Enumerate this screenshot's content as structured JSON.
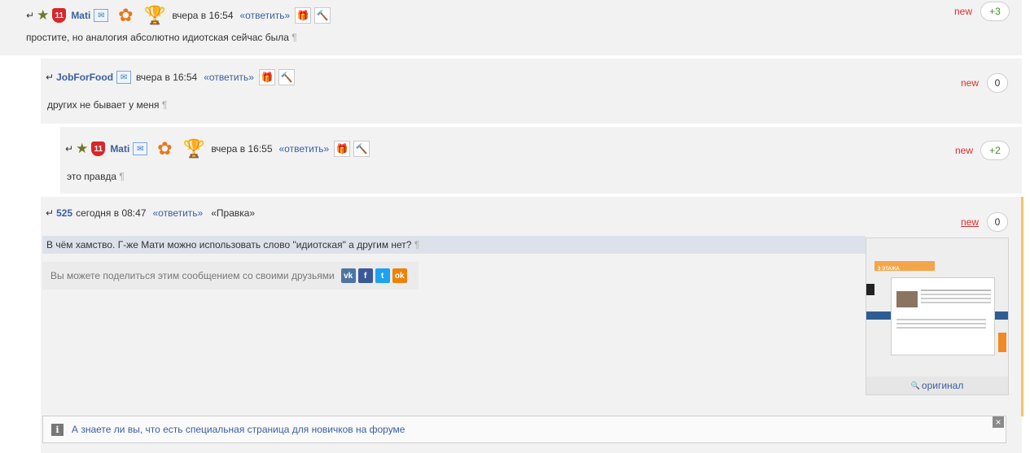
{
  "comments": [
    {
      "username": "Mati",
      "shield": "11",
      "date": "вчера в 16:54",
      "reply_label": "«ответить»",
      "text": "простите, но аналогия абсолютно идиотская сейчас была",
      "pilcrow": "¶",
      "new_label": "new",
      "rating": "+3"
    },
    {
      "username": "JobForFood",
      "date": "вчера в 16:54",
      "reply_label": "«ответить»",
      "text": "других не бывает у меня",
      "pilcrow": "¶",
      "new_label": "new",
      "rating": "0"
    },
    {
      "username": "Mati",
      "shield": "11",
      "date": "вчера в 16:55",
      "reply_label": "«ответить»",
      "text": "это правда",
      "pilcrow": "¶",
      "new_label": "new",
      "rating": "+2"
    },
    {
      "username": "525",
      "date": "сегодня в 08:47",
      "reply_label": "«ответить»",
      "edit_label": "«Правка»",
      "text": "В чём хамство. Г-же Мати можно использовать слово \"идиотская\" а другим нет?",
      "pilcrow": "¶",
      "new_label": "new",
      "rating": "0",
      "share_label": "Вы можете поделиться этим сообщением со своими друзьями",
      "share_buttons": [
        "vk",
        "f",
        "t",
        "ok"
      ],
      "attachment": {
        "thumb_banner": "3 ЭТАЖА",
        "original_label": "оригинал"
      }
    }
  ],
  "icons": {
    "reply_arrow": "↵",
    "star": "★",
    "mail": "✉",
    "flowers": "✿",
    "trophy": "🏆",
    "gift": "🎁",
    "hammer": "🔨",
    "info": "i",
    "close": "×",
    "magnifier": "🔍"
  },
  "tip": {
    "text": "А знаете ли вы, что есть специальная страница для новичков на форуме"
  },
  "colors": {
    "link": "#3a5fa0",
    "new": "#d9302c",
    "positive": "#3f8f2a",
    "comment_bg": "#f2f2f2",
    "highlight_bg": "#dde2ea",
    "accent_border": "#f5c26b"
  }
}
